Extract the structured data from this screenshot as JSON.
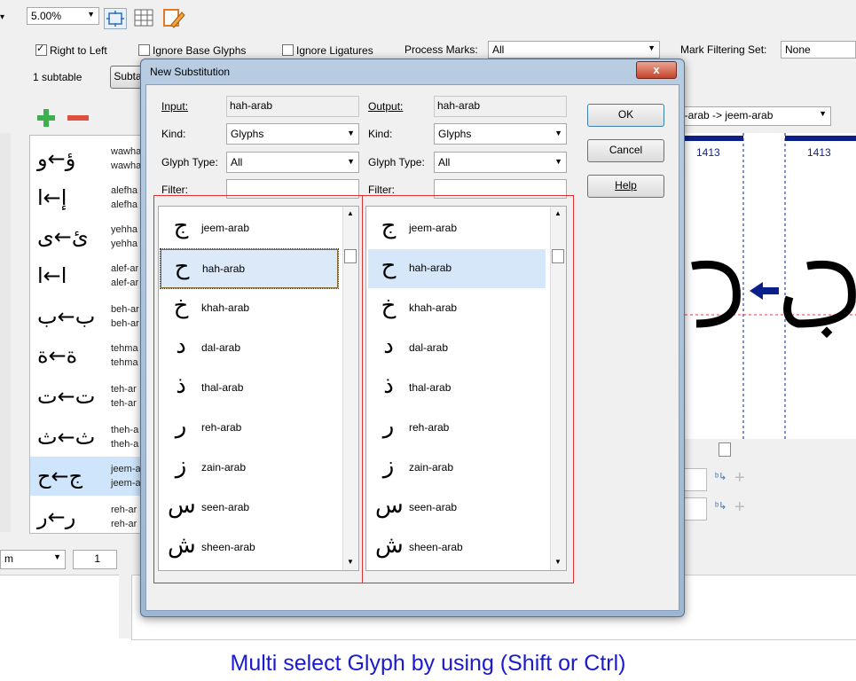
{
  "toolbar": {
    "zoom_value": "5.00%"
  },
  "options": {
    "right_to_left": "Right to Left",
    "ignore_base_glyphs": "Ignore Base Glyphs",
    "ignore_ligatures": "Ignore Ligatures",
    "process_marks_label": "Process Marks:",
    "process_marks_value": "All",
    "mark_filtering_label": "Mark Filtering Set:",
    "mark_filtering_value": "None"
  },
  "subtables": {
    "count_label": "1 subtable",
    "button_label": "Subta"
  },
  "sidebar": {
    "items": [
      {
        "glyph": "ؤ←و",
        "n1": "wawha",
        "n2": "wawha"
      },
      {
        "glyph": "إ←ا",
        "n1": "alefha",
        "n2": "alefha"
      },
      {
        "glyph": "ئ←ى",
        "n1": "yehha",
        "n2": "yehha"
      },
      {
        "glyph": "ا←ا",
        "n1": "alef-ar",
        "n2": "alef-ar"
      },
      {
        "glyph": "ب←ب",
        "n1": "beh-ar",
        "n2": "beh-ar"
      },
      {
        "glyph": "ة←ة",
        "n1": "tehma",
        "n2": "tehma"
      },
      {
        "glyph": "ت←ت",
        "n1": "teh-ar",
        "n2": "teh-ar"
      },
      {
        "glyph": "ث←ث",
        "n1": "theh-a",
        "n2": "theh-a"
      },
      {
        "glyph": "ج←ح",
        "n1": "jeem-a",
        "n2": "jeem-a"
      },
      {
        "glyph": "ر←ر",
        "n1": "reh-ar",
        "n2": "reh-ar"
      }
    ]
  },
  "preview": {
    "rule_label": "n-arab -> jeem-arab",
    "left_num": "1413",
    "right_num": "1413"
  },
  "bottom": {
    "unit_value": "m",
    "page_value": "1"
  },
  "dialog": {
    "title": "New Substitution",
    "close": "x",
    "input_label": "Input:",
    "input_value": "hah-arab",
    "output_label": "Output:",
    "output_value": "hah-arab",
    "kind_label": "Kind:",
    "kind_value": "Glyphs",
    "glyph_type_label": "Glyph Type:",
    "glyph_type_value": "All",
    "filter_label": "Filter:",
    "ok_label": "OK",
    "cancel_label": "Cancel",
    "help_label": "Help",
    "glyphs": [
      {
        "glyph": "ج",
        "name": "jeem-arab"
      },
      {
        "glyph": "ح",
        "name": "hah-arab"
      },
      {
        "glyph": "خ",
        "name": "khah-arab"
      },
      {
        "glyph": "د",
        "name": "dal-arab"
      },
      {
        "glyph": "ذ",
        "name": "thal-arab"
      },
      {
        "glyph": "ر",
        "name": "reh-arab"
      },
      {
        "glyph": "ز",
        "name": "zain-arab"
      },
      {
        "glyph": "س",
        "name": "seen-arab"
      },
      {
        "glyph": "ش",
        "name": "sheen-arab"
      }
    ]
  },
  "caption": "Multi select Glyph by using (Shift or Ctrl)"
}
